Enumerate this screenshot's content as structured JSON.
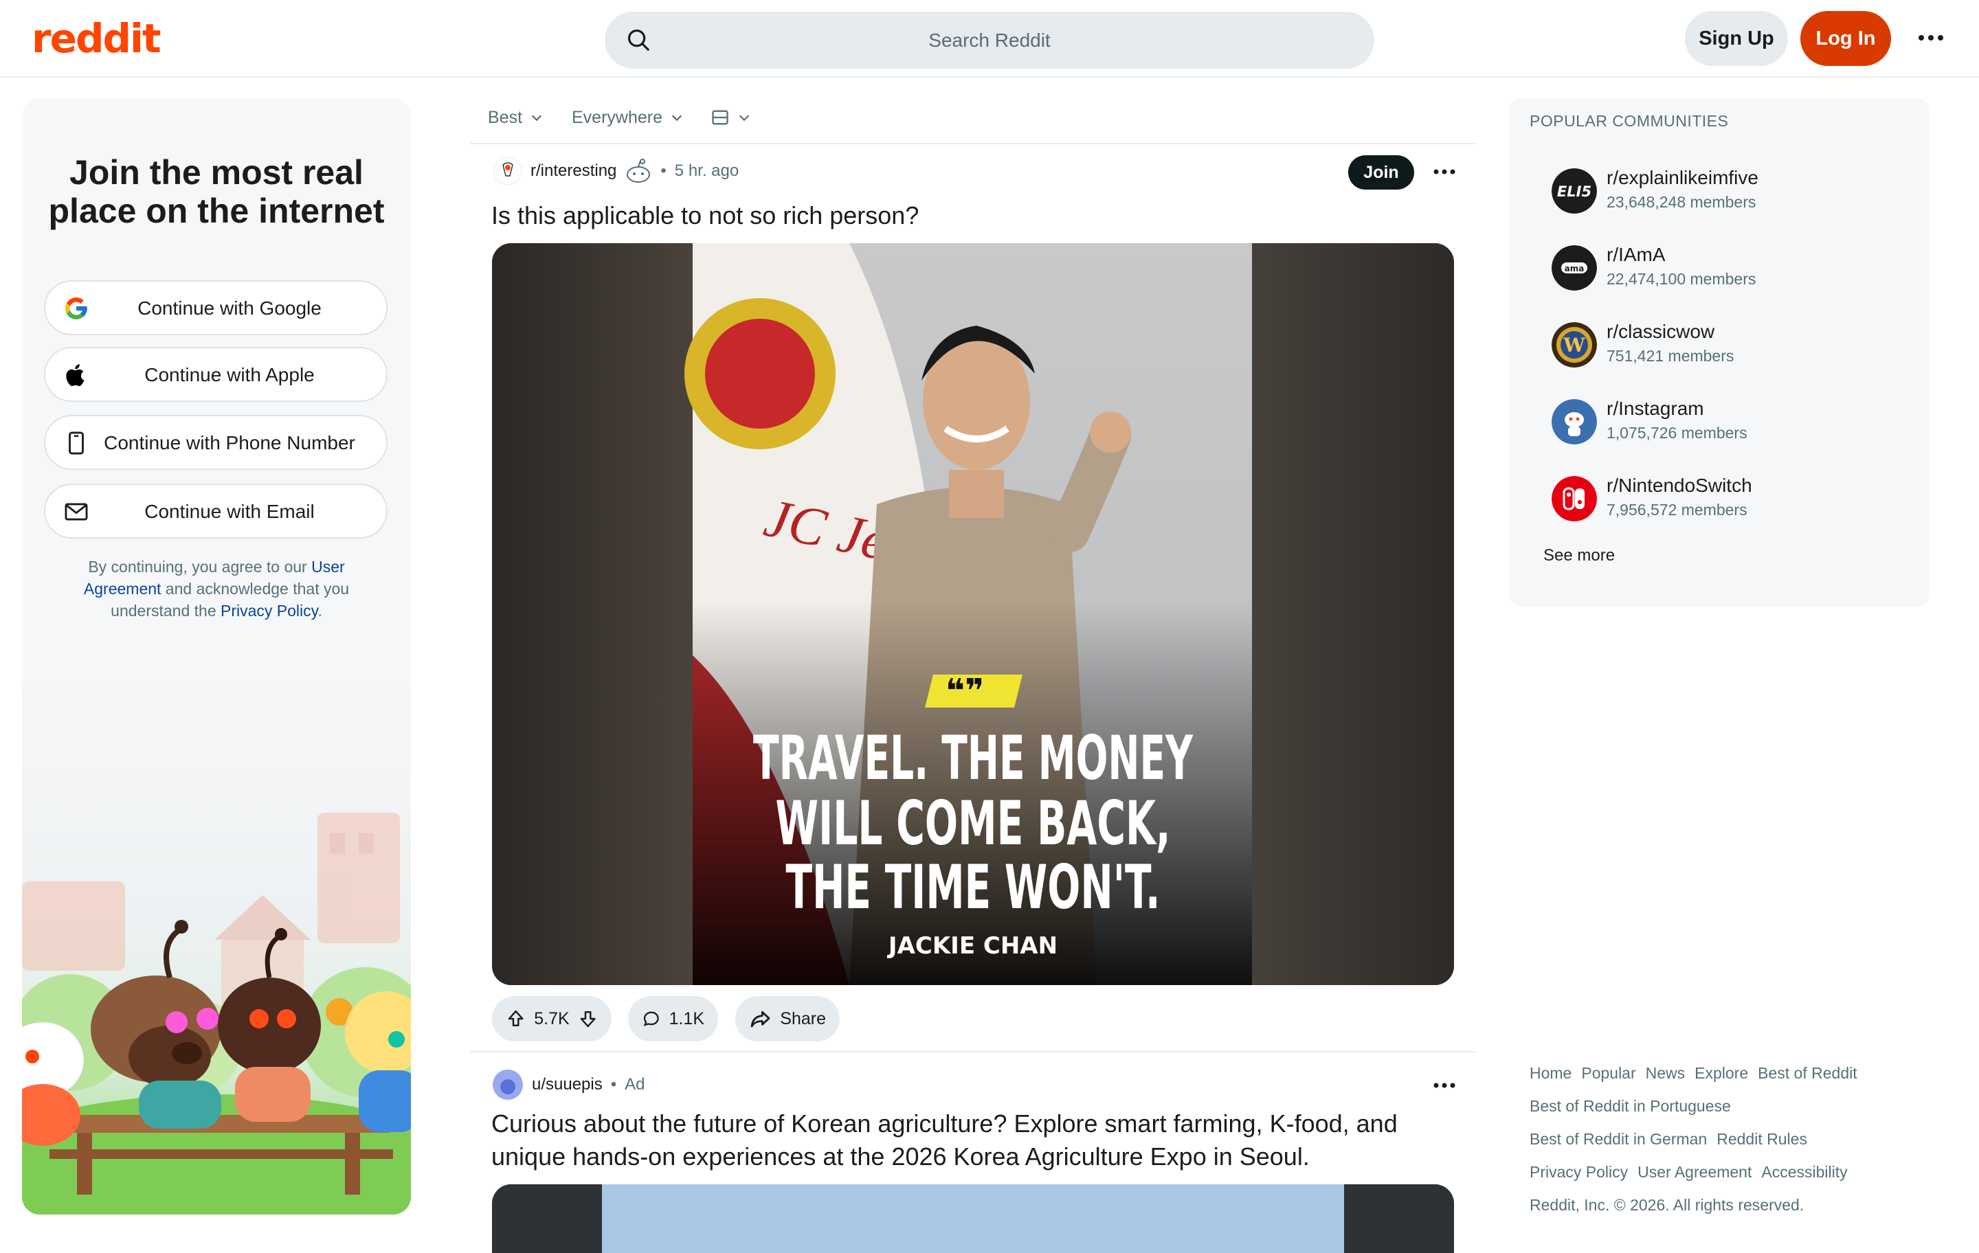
{
  "header": {
    "logo_text": "reddit",
    "search_placeholder": "Search Reddit",
    "signup_label": "Sign Up",
    "login_label": "Log In"
  },
  "left": {
    "title_line1": "Join the most real",
    "title_line2": "place on the internet",
    "buttons": [
      {
        "label": "Continue with Google",
        "icon": "google-icon"
      },
      {
        "label": "Continue with Apple",
        "icon": "apple-icon"
      },
      {
        "label": "Continue with Phone Number",
        "icon": "phone-icon"
      },
      {
        "label": "Continue with Email",
        "icon": "email-icon"
      }
    ],
    "legal_prefix": "By continuing, you agree to our ",
    "legal_link1": "User Agreement",
    "legal_middle": " and acknowledge that you understand the ",
    "legal_link2": "Privacy Policy",
    "legal_suffix": "."
  },
  "feed": {
    "sort": "Best",
    "location": "Everywhere",
    "posts": [
      {
        "subreddit": "r/interesting",
        "time": "5 hr. ago",
        "title": "Is this applicable to not so rich person?",
        "join_label": "Join",
        "image_quote_line1": "TRAVEL. THE MONEY",
        "image_quote_line2": "WILL COME BACK,",
        "image_quote_line3": "THE TIME WON'T.",
        "image_author": "JACKIE CHAN",
        "image_plane_text": "JC Jet",
        "upvotes": "5.7K",
        "comments": "1.1K",
        "share_label": "Share"
      },
      {
        "user": "u/suuepis",
        "tag": "Ad",
        "title": "Curious about the future of Korean agriculture? Explore smart farming, K-food, and unique hands-on experiences at the 2026 Korea Agriculture Expo in Seoul."
      }
    ]
  },
  "sidebar": {
    "heading": "POPULAR COMMUNITIES",
    "communities": [
      {
        "name": "r/explainlikeimfive",
        "members": "23,648,248 members",
        "avatar_text": "ELI5",
        "color": "#1c1c1c"
      },
      {
        "name": "r/IAmA",
        "members": "22,474,100 members",
        "avatar_text": "ama",
        "color": "#1c1c1c"
      },
      {
        "name": "r/classicwow",
        "members": "751,421 members",
        "avatar_text": "W",
        "color": "#8a6a1c"
      },
      {
        "name": "r/Instagram",
        "members": "1,075,726 members",
        "avatar_text": "",
        "color": "#3a6fb0"
      },
      {
        "name": "r/NintendoSwitch",
        "members": "7,956,572 members",
        "avatar_text": "",
        "color": "#e60012"
      }
    ],
    "see_more": "See more"
  },
  "footer": {
    "links": [
      "Home",
      "Popular",
      "News",
      "Explore",
      "Best of Reddit",
      "Best of Reddit in Portuguese",
      "Best of Reddit in German",
      "Reddit Rules",
      "Privacy Policy",
      "User Agreement",
      "Accessibility"
    ],
    "copyright": "Reddit, Inc. © 2026. All rights reserved."
  }
}
